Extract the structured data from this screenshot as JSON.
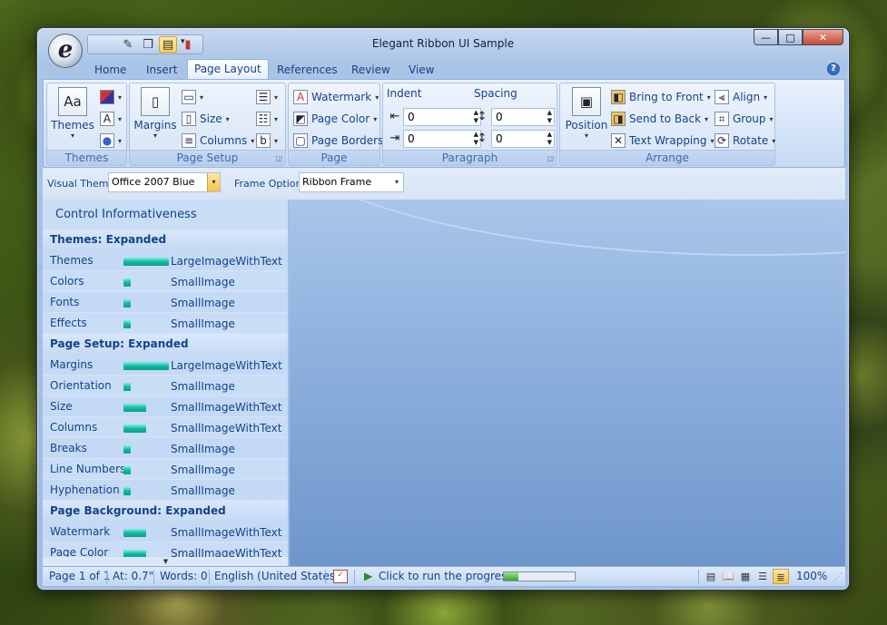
{
  "window": {
    "title": "Elegant Ribbon UI Sample",
    "app_letter": "e"
  },
  "qat": {
    "items": [
      "paint-icon",
      "copy-icon",
      "layout-icon",
      "chart-icon"
    ],
    "dropdown": "▾"
  },
  "caption": {
    "min": "—",
    "max": "□",
    "close": "✕"
  },
  "tabs": [
    "Home",
    "Insert",
    "Page Layout",
    "References",
    "Review",
    "View"
  ],
  "active_tab": "Page Layout",
  "help": "?",
  "ribbon": {
    "themes": {
      "label": "Themes",
      "button": "Themes"
    },
    "page_setup": {
      "label": "Page Setup",
      "margins": "Margins",
      "size": "Size",
      "columns": "Columns"
    },
    "page_background": {
      "label": "Page Background",
      "watermark": "Watermark",
      "page_color": "Page Color",
      "page_borders": "Page Borders"
    },
    "paragraph": {
      "label": "Paragraph",
      "indent": "Indent",
      "spacing": "Spacing",
      "indent_left": "0",
      "indent_right": "0",
      "spacing_before": "0",
      "spacing_after": "0"
    },
    "arrange": {
      "label": "Arrange",
      "position": "Position",
      "bring_to_front": "Bring to Front",
      "send_to_back": "Send to Back",
      "text_wrapping": "Text Wrapping",
      "align": "Align",
      "group": "Group",
      "rotate": "Rotate"
    }
  },
  "options": {
    "visual_theme_label": "Visual Theme",
    "visual_theme_value": "Office 2007 Blue",
    "frame_options_label": "Frame Options",
    "frame_options_value": "Ribbon Frame"
  },
  "side": {
    "title": "Control Informativeness",
    "sections": [
      {
        "title": "Themes: Expanded",
        "rows": [
          {
            "name": "Themes",
            "level": 1.0,
            "mode": "LargeImageWithText"
          },
          {
            "name": "Colors",
            "level": 0.15,
            "mode": "SmallImage"
          },
          {
            "name": "Fonts",
            "level": 0.15,
            "mode": "SmallImage"
          },
          {
            "name": "Effects",
            "level": 0.15,
            "mode": "SmallImage"
          }
        ]
      },
      {
        "title": "Page Setup: Expanded",
        "rows": [
          {
            "name": "Margins",
            "level": 1.0,
            "mode": "LargeImageWithText"
          },
          {
            "name": "Orientation",
            "level": 0.15,
            "mode": "SmallImage"
          },
          {
            "name": "Size",
            "level": 0.5,
            "mode": "SmallImageWithText"
          },
          {
            "name": "Columns",
            "level": 0.5,
            "mode": "SmallImageWithText"
          },
          {
            "name": "Breaks",
            "level": 0.15,
            "mode": "SmallImage"
          },
          {
            "name": "Line Numbers",
            "level": 0.15,
            "mode": "SmallImage"
          },
          {
            "name": "Hyphenation",
            "level": 0.15,
            "mode": "SmallImage"
          }
        ]
      },
      {
        "title": "Page Background: Expanded",
        "rows": [
          {
            "name": "Watermark",
            "level": 0.5,
            "mode": "SmallImageWithText"
          },
          {
            "name": "Page Color",
            "level": 0.5,
            "mode": "SmallImageWithText"
          }
        ]
      }
    ]
  },
  "status": {
    "page": "Page 1 of 1",
    "at": "At: 0.7\"",
    "words": "Words: 0",
    "language": "English (United States)",
    "run_progress": "Click to run the progress",
    "progress": 0.2,
    "zoom": "100%"
  }
}
